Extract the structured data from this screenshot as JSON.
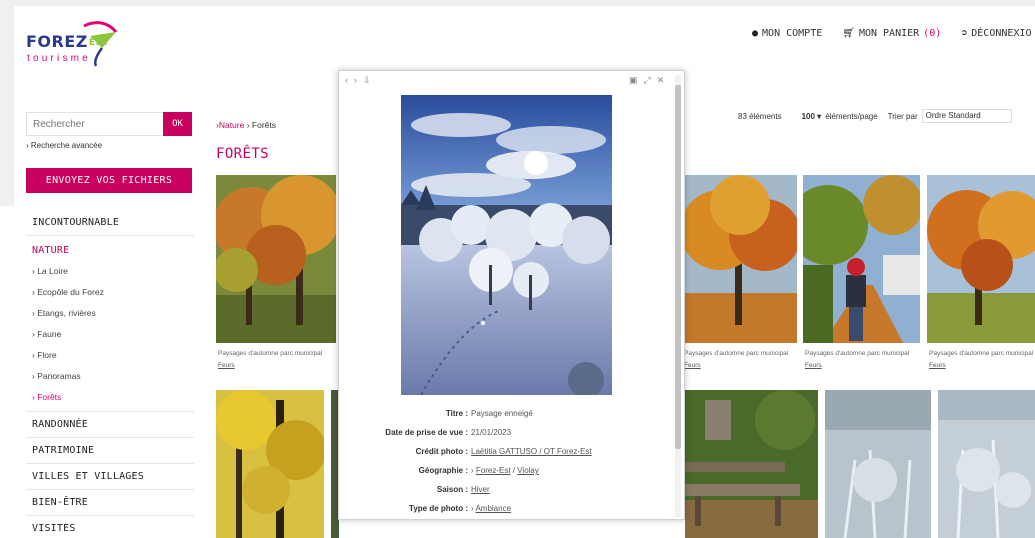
{
  "brand": {
    "name": "FOREZ",
    "sub": "EST",
    "tagline": "tourisme"
  },
  "topnav": {
    "account": "MON COMPTE",
    "cart": "MON PANIER",
    "cart_count": "(0)",
    "logout": "DÉCONNEXIO"
  },
  "search": {
    "placeholder": "Rechercher",
    "button": "OK",
    "advanced": "› Recherche avancée"
  },
  "upload_button": "ENVOYEZ VOS FICHIERS",
  "categories": {
    "incontournable": "INCONTOURNABLE",
    "nature": "NATURE",
    "nature_sub": [
      "› La Loire",
      "› Ecopôle du Forez",
      "› Etangs, rivières",
      "› Faune",
      "› Flore",
      "› Panoramas",
      "› Forêts"
    ],
    "randonnee": "RANDONNÉE",
    "patrimoine": "PATRIMOINE",
    "villes": "VILLES ET VILLAGES",
    "bienetre": "BIEN-ÊTRE",
    "visites": "VISITES"
  },
  "breadcrumb": {
    "nature": "›Nature",
    "forets": "› Forêts"
  },
  "page_title": "FORÊTS",
  "toolbar": {
    "count": "83 éléments",
    "per_page_value": "100 ▾",
    "per_page_label": "éléments/page",
    "sort_label": "Trier par",
    "sort_value": "Ordre Standard"
  },
  "grid_captions": [
    {
      "title": "Paysages d'automne parc municipal",
      "tag": "Feurs"
    },
    {
      "title": "Paysages d'automne parc municipal",
      "tag": "Feurs"
    },
    {
      "title": "Paysages d'automne parc municipal",
      "tag": "Feurs"
    },
    {
      "title": "Paysages d'automne parc municipal",
      "tag": "Feurs"
    }
  ],
  "modal": {
    "toolbar_left": [
      "‹",
      "›",
      "⇩"
    ],
    "toolbar_right": [
      "▣",
      "⤢",
      "✕"
    ],
    "fields": {
      "titre_k": "Titre :",
      "titre_v": "Paysage enneigé",
      "date_k": "Date de prise de vue :",
      "date_v": "21/01/2023",
      "credit_k": "Crédit photo :",
      "credit_v": "Laëtitia GATTUSO / OT Forez-Est",
      "geo_k": "Géographie :",
      "geo_prefix": "› ",
      "geo_v1": "Forez-Est",
      "geo_sep": " / ",
      "geo_v2": "Violay",
      "saison_k": "Saison :",
      "saison_v": "Hiver",
      "type_k": "Type de photo :",
      "type_prefix": "› ",
      "type_v": "Ambiance"
    }
  },
  "colors": {
    "accent": "#c8005e",
    "brand_blue": "#2c3a8c",
    "brand_green": "#8cc63f"
  }
}
